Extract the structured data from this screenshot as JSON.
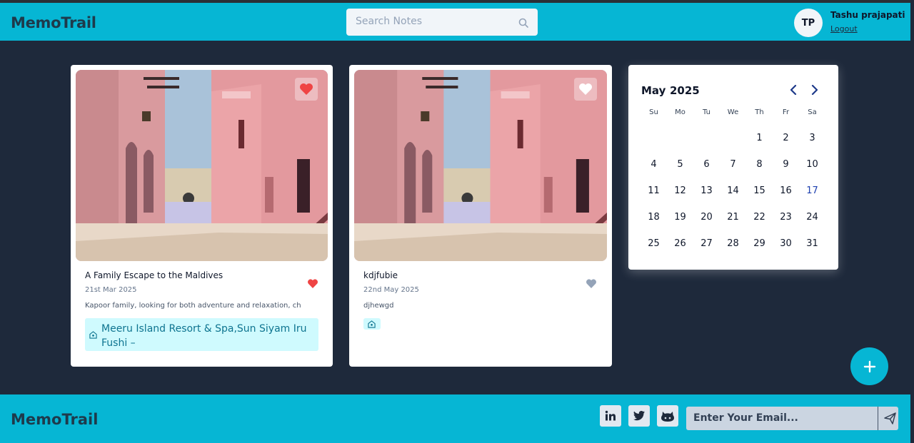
{
  "header": {
    "brand": "MemoTrail",
    "search_placeholder": "Search Notes",
    "user_initials": "TP",
    "user_name": "Tashu prajapati",
    "logout_label": "Logout"
  },
  "notes": [
    {
      "title": "A Family Escape to the Maldives",
      "date": "21st Mar 2025",
      "description": "Kapoor family, looking for both adventure and relaxation, ch",
      "location": "Meeru Island Resort & Spa,Sun Siyam Iru Fushi –",
      "favorite": true
    },
    {
      "title": "kdjfubie",
      "date": "22nd May 2025",
      "description": "djhewgd",
      "location": "",
      "favorite": false
    }
  ],
  "calendar": {
    "month": "May",
    "year": "2025",
    "weekdays": [
      "Su",
      "Mo",
      "Tu",
      "We",
      "Th",
      "Fr",
      "Sa"
    ],
    "today": "17",
    "weeks": [
      [
        "",
        "",
        "",
        "",
        "1",
        "2",
        "3"
      ],
      [
        "4",
        "5",
        "6",
        "7",
        "8",
        "9",
        "10"
      ],
      [
        "11",
        "12",
        "13",
        "14",
        "15",
        "16",
        "17"
      ],
      [
        "18",
        "19",
        "20",
        "21",
        "22",
        "23",
        "24"
      ],
      [
        "25",
        "26",
        "27",
        "28",
        "29",
        "30",
        "31"
      ]
    ]
  },
  "footer": {
    "brand": "MemoTrail",
    "email_placeholder": "Enter Your Email...",
    "social": [
      "linkedin-icon",
      "twitter-icon",
      "github-icon"
    ]
  },
  "colors": {
    "accent": "#06b6d4",
    "background": "#1e293b",
    "favorite": "#ef4444",
    "location_bg": "#cffafe",
    "location_text": "#0e7490"
  }
}
